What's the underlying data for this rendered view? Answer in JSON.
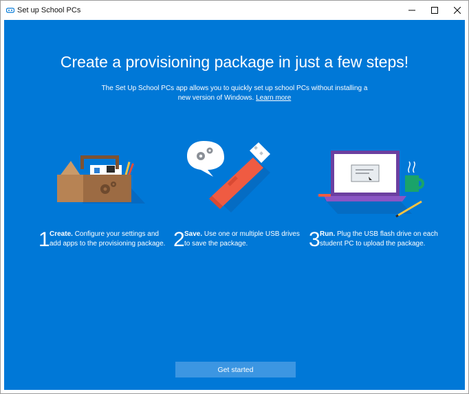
{
  "window": {
    "title": "Set up School PCs",
    "controls": [
      "minimize-icon",
      "maximize-icon",
      "close-icon"
    ]
  },
  "main": {
    "headline": "Create a provisioning package in just a few steps!",
    "subtitle": "The Set Up School PCs app allows you to quickly set up school PCs without installing a new version of Windows.",
    "learn_more": "Learn more",
    "illustrations": [
      "toolbox-illustration",
      "usb-drive-illustration",
      "laptop-illustration"
    ],
    "steps": [
      {
        "number": "1",
        "title": "Create.",
        "text": "Configure your settings and add apps to the provisioning package."
      },
      {
        "number": "2",
        "title": "Save.",
        "text": "Use one or multiple USB drives to save the package."
      },
      {
        "number": "3",
        "title": "Run.",
        "text": "Plug the USB flash drive on each student PC to upload the package."
      }
    ],
    "get_started": "Get started"
  },
  "colors": {
    "background": "#0078d7",
    "button": "#3c96e2",
    "usb": "#ef5b42",
    "laptop": "#6b3fa0",
    "mug": "#1aa36a",
    "toolbox": "#9c6b43"
  }
}
